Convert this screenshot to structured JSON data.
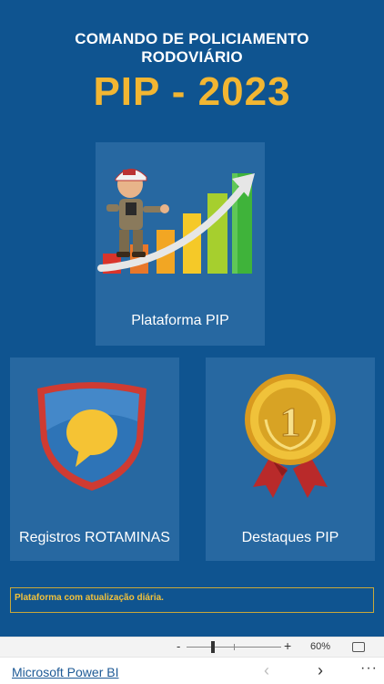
{
  "header": {
    "title_line1": "COMANDO DE POLICIAMENTO",
    "title_line2": "RODOVIÁRIO",
    "subtitle": "PIP - 2023"
  },
  "tiles": {
    "plataforma": {
      "label": "Plataforma PIP",
      "icon": "growth-chart-mascot-icon"
    },
    "registros": {
      "label": "Registros ROTAMINAS",
      "icon": "speech-shield-icon"
    },
    "destaques": {
      "label": "Destaques PIP",
      "icon": "gold-medal-icon"
    }
  },
  "footer": {
    "note": "Plataforma com atualização diária."
  },
  "zoom": {
    "minus": "-",
    "plus": "+",
    "level": "60%",
    "fit_icon": "fit-to-page-icon"
  },
  "bottom": {
    "brand": "Microsoft Power BI",
    "prev": "‹",
    "next": "›",
    "more": "···"
  },
  "colors": {
    "background": "#0f5490",
    "tile": "#2768a1",
    "accent": "#f2b632",
    "footer_border": "#c9a83a"
  }
}
